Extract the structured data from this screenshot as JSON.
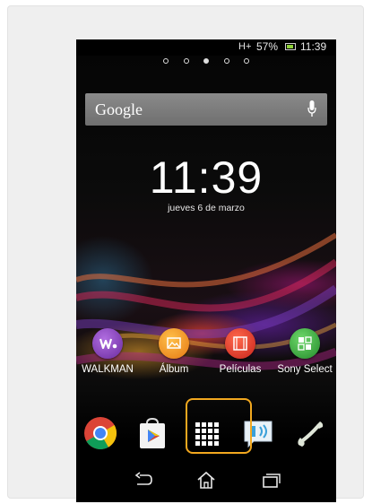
{
  "status_bar": {
    "signal": "H+",
    "battery": "57%",
    "time": "11:39"
  },
  "pages": {
    "count": 5,
    "active_index": 2
  },
  "search": {
    "label": "Google"
  },
  "clock": {
    "time": "11:39",
    "date": "jueves 6 de marzo"
  },
  "apps": [
    {
      "label": "WALKMAN",
      "icon": "walkman-icon",
      "color": "#7b3fb2"
    },
    {
      "label": "Álbum",
      "icon": "album-icon",
      "color": "#f08a1c"
    },
    {
      "label": "Películas",
      "icon": "movies-icon",
      "color": "#e23a2a"
    },
    {
      "label": "Sony Select",
      "icon": "sony-select-icon",
      "color": "#3aa83a"
    }
  ],
  "dock": [
    {
      "icon": "chrome-icon"
    },
    {
      "icon": "play-store-icon"
    },
    {
      "icon": "app-drawer-icon",
      "highlighted": true
    },
    {
      "icon": "messaging-icon"
    },
    {
      "icon": "phone-icon"
    }
  ],
  "navigation": [
    {
      "icon": "back-icon"
    },
    {
      "icon": "home-icon"
    },
    {
      "icon": "recent-apps-icon"
    }
  ],
  "colors": {
    "highlight": "#f2a81f"
  }
}
